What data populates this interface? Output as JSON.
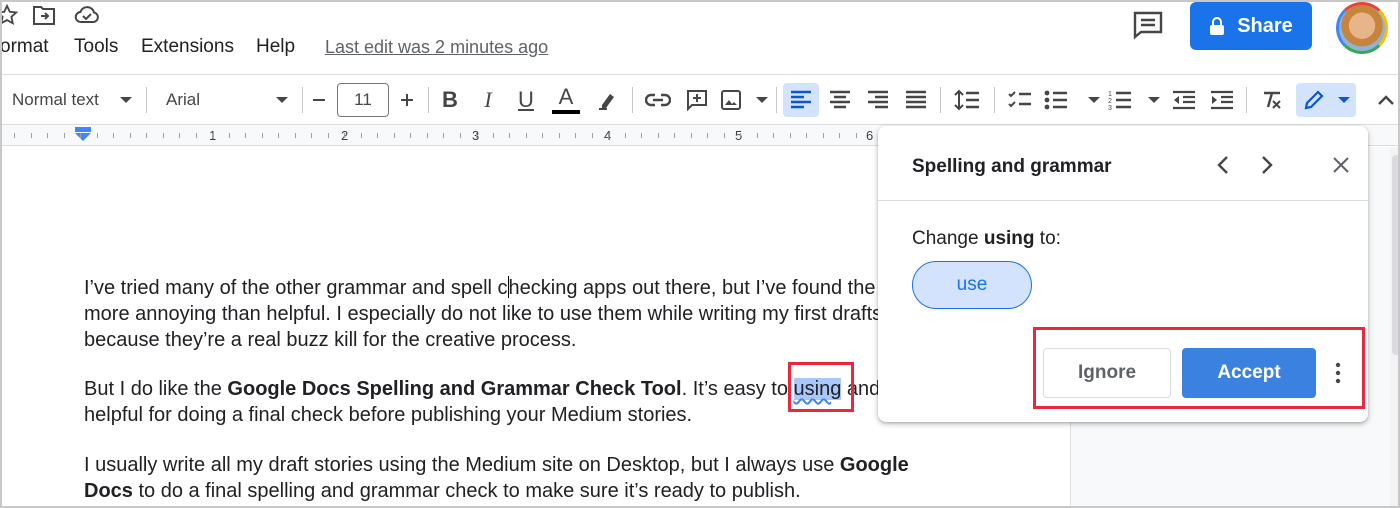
{
  "menu": {
    "items": [
      "ormat",
      "Tools",
      "Extensions",
      "Help"
    ],
    "last_edit": "Last edit was 2 minutes ago"
  },
  "header": {
    "share_label": "Share"
  },
  "toolbar": {
    "style_value": "Normal text",
    "font_value": "Arial",
    "font_size": "11",
    "bold_label": "B",
    "italic_label": "I",
    "underline_label": "U",
    "text_color_label": "A"
  },
  "ruler": {
    "numbers": [
      "1",
      "2",
      "3",
      "4",
      "5",
      "6"
    ]
  },
  "document": {
    "p1_line1_a": "I’ve tried many of the other grammar and spell c",
    "p1_line1_b": "hecking apps out there, but I’ve found the",
    "p1_line2": "more annoying than helpful. I especially do not like to use them while writing my first drafts",
    "p1_line3": "because they’re a real buzz kill for the creative process.",
    "p2_line1_a": "But I do like the ",
    "p2_line1_bold": "Google Docs Spelling and Grammar Check Tool",
    "p2_line1_b": ". It’s easy to ",
    "p2_line1_word": "using",
    "p2_line1_c": " and",
    "p2_line2": "helpful for doing a final check before publishing your Medium stories.",
    "p3_line1_a": "I usually write all my draft stories using the Medium site on Desktop, but I always use ",
    "p3_line1_bold": "Google",
    "p3_line2_bold": "Docs",
    "p3_line2_b": " to do a final spelling and grammar check to make sure it’s ready to publish."
  },
  "spelling_panel": {
    "title": "Spelling and grammar",
    "change_prefix": "Change ",
    "change_word": "using",
    "change_suffix": " to:",
    "suggestion": "use",
    "ignore_label": "Ignore",
    "accept_label": "Accept"
  },
  "colors": {
    "accent": "#1a73e8",
    "highlight_box": "#e8283e"
  }
}
